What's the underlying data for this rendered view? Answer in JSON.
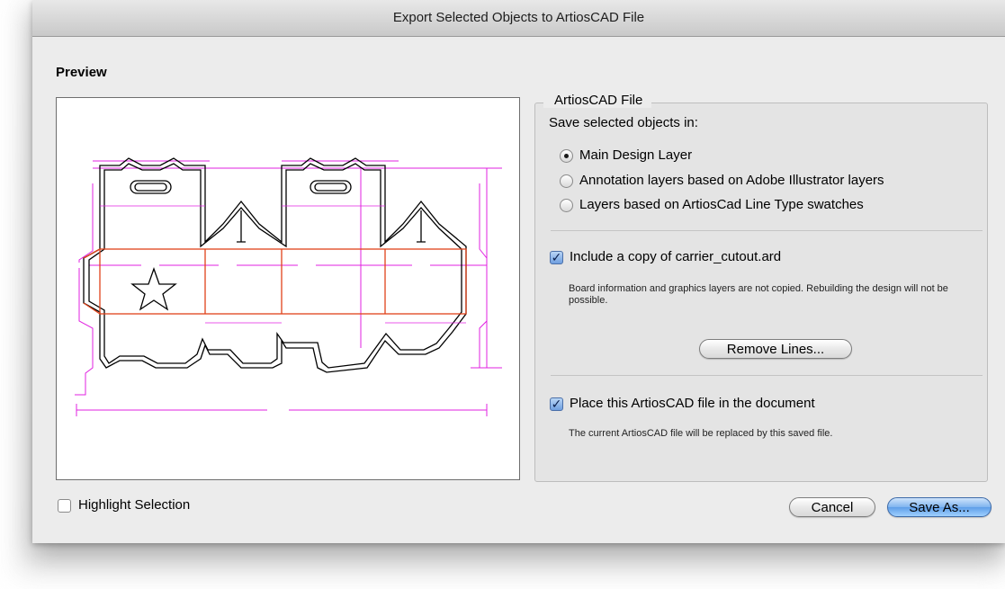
{
  "window": {
    "title": "Export Selected Objects to ArtiosCAD File"
  },
  "preview": {
    "label": "Preview"
  },
  "artioscad": {
    "legend": "ArtiosCAD File",
    "save_in_label": "Save selected objects in:",
    "options": [
      {
        "label": "Main Design Layer",
        "selected": true
      },
      {
        "label": "Annotation layers based on Adobe Illustrator layers",
        "selected": false
      },
      {
        "label": "Layers based on ArtiosCad Line Type swatches",
        "selected": false
      }
    ],
    "include_copy": {
      "checked": true,
      "label": "Include a copy of carrier_cutout.ard",
      "note": "Board information and graphics layers are not copied.  Rebuilding the design will not be possible.",
      "remove_lines_label": "Remove Lines..."
    },
    "place_file": {
      "checked": true,
      "label": "Place this ArtiosCAD file in the document",
      "note": "The current ArtiosCAD file will be replaced by this saved file."
    }
  },
  "highlight_selection": {
    "checked": false,
    "label": "Highlight Selection"
  },
  "buttons": {
    "cancel": "Cancel",
    "save_as": "Save As..."
  },
  "colors": {
    "die_line": "#000000",
    "crease_line": "#e0421a",
    "dimension": "#e020e0",
    "default_button": "#6fa8ee"
  },
  "check_glyph": "✓"
}
